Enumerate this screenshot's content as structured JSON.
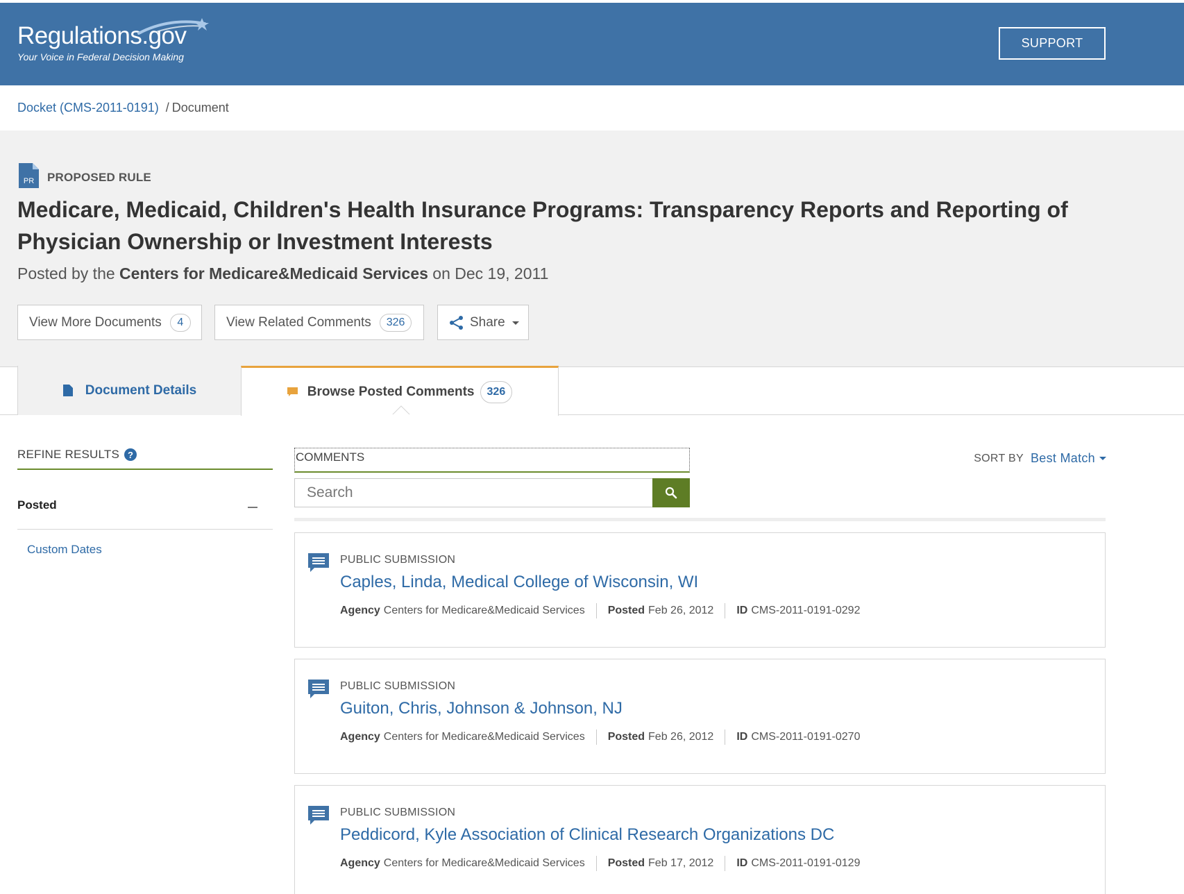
{
  "header": {
    "logo_text": "Regulations.gov",
    "tagline": "Your Voice in Federal Decision Making",
    "support_label": "SUPPORT"
  },
  "breadcrumb": {
    "docket_link": "Docket (CMS-2011-0191)",
    "separator": "/",
    "current": "Document"
  },
  "document": {
    "type_icon_text": "PR",
    "type_label": "PROPOSED RULE",
    "title": "Medicare, Medicaid, Children's Health Insurance Programs: Transparency Reports and Reporting of Physician Ownership or Investment Interests",
    "posted_prefix": "Posted by the ",
    "agency": "Centers for Medicare&Medicaid Services",
    "posted_suffix": " on Dec 19, 2011"
  },
  "actions": {
    "more_documents_label": "View More Documents",
    "more_documents_count": "4",
    "related_comments_label": "View Related Comments",
    "related_comments_count": "326",
    "share_label": "Share"
  },
  "tabs": {
    "details_label": "Document Details",
    "browse_label": "Browse Posted Comments",
    "browse_count": "326"
  },
  "sidebar": {
    "refine_label": "REFINE RESULTS",
    "help_glyph": "?",
    "posted_label": "Posted",
    "custom_dates_label": "Custom Dates"
  },
  "search": {
    "section_label": "COMMENTS",
    "placeholder": "Search",
    "sort_label": "SORT BY",
    "sort_value": "Best Match"
  },
  "results": [
    {
      "type": "PUBLIC SUBMISSION",
      "title": "Caples, Linda, Medical College of Wisconsin, WI",
      "agency_label": "Agency",
      "agency": "Centers for Medicare&Medicaid Services",
      "posted_label": "Posted",
      "posted": "Feb 26, 2012",
      "id_label": "ID",
      "id": "CMS-2011-0191-0292"
    },
    {
      "type": "PUBLIC SUBMISSION",
      "title": "Guiton, Chris, Johnson & Johnson, NJ",
      "agency_label": "Agency",
      "agency": "Centers for Medicare&Medicaid Services",
      "posted_label": "Posted",
      "posted": "Feb 26, 2012",
      "id_label": "ID",
      "id": "CMS-2011-0191-0270"
    },
    {
      "type": "PUBLIC SUBMISSION",
      "title": "Peddicord, Kyle Association of Clinical Research Organizations DC",
      "agency_label": "Agency",
      "agency": "Centers for Medicare&Medicaid Services",
      "posted_label": "Posted",
      "posted": "Feb 17, 2012",
      "id_label": "ID",
      "id": "CMS-2011-0191-0129"
    }
  ],
  "colors": {
    "header_blue": "#3f72a6",
    "link_blue": "#2e6aa6",
    "accent_green": "#5e7d25",
    "tab_orange": "#e8a33d"
  },
  "icons": {
    "document": "document-icon",
    "comment": "comment-icon",
    "share": "share-icon",
    "search": "search-icon",
    "help": "help-icon",
    "collapse": "minus-icon"
  }
}
